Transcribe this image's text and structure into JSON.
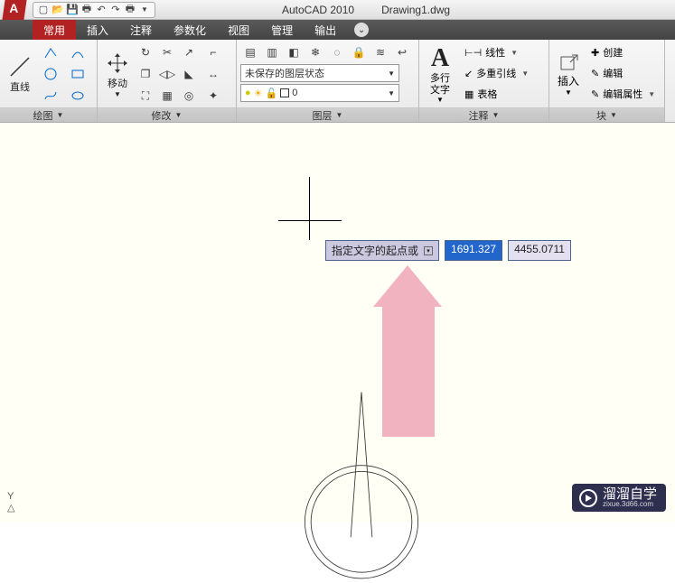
{
  "title": {
    "app": "AutoCAD 2010",
    "doc": "Drawing1.dwg"
  },
  "menu": {
    "items": [
      "常用",
      "插入",
      "注释",
      "参数化",
      "视图",
      "管理",
      "输出"
    ],
    "active_index": 0
  },
  "ribbon": {
    "draw": {
      "title": "绘图",
      "line_label": "直线"
    },
    "modify": {
      "title": "修改",
      "move_label": "移动"
    },
    "layer": {
      "title": "图层",
      "state_label": "未保存的图层状态"
    },
    "annotate": {
      "title": "注释",
      "mtext_label": "多行\n文字",
      "items": [
        "线性",
        "多重引线",
        "表格"
      ]
    },
    "block": {
      "title": "块",
      "insert_label": "插入",
      "items": [
        "创建",
        "编辑",
        "编辑属性"
      ]
    }
  },
  "canvas": {
    "prompt": "指定文字的起点或",
    "coord_x": "1691.327",
    "coord_y": "4455.0711",
    "ucs_y": "Y"
  },
  "watermark": {
    "text": "溜溜自学",
    "sub": "zixue.3d66.com"
  },
  "icons": {
    "new": "new-icon",
    "open": "open-icon",
    "save": "save-icon",
    "plot": "plot-icon",
    "undo": "undo-icon",
    "redo": "redo-icon",
    "print": "print-icon"
  }
}
